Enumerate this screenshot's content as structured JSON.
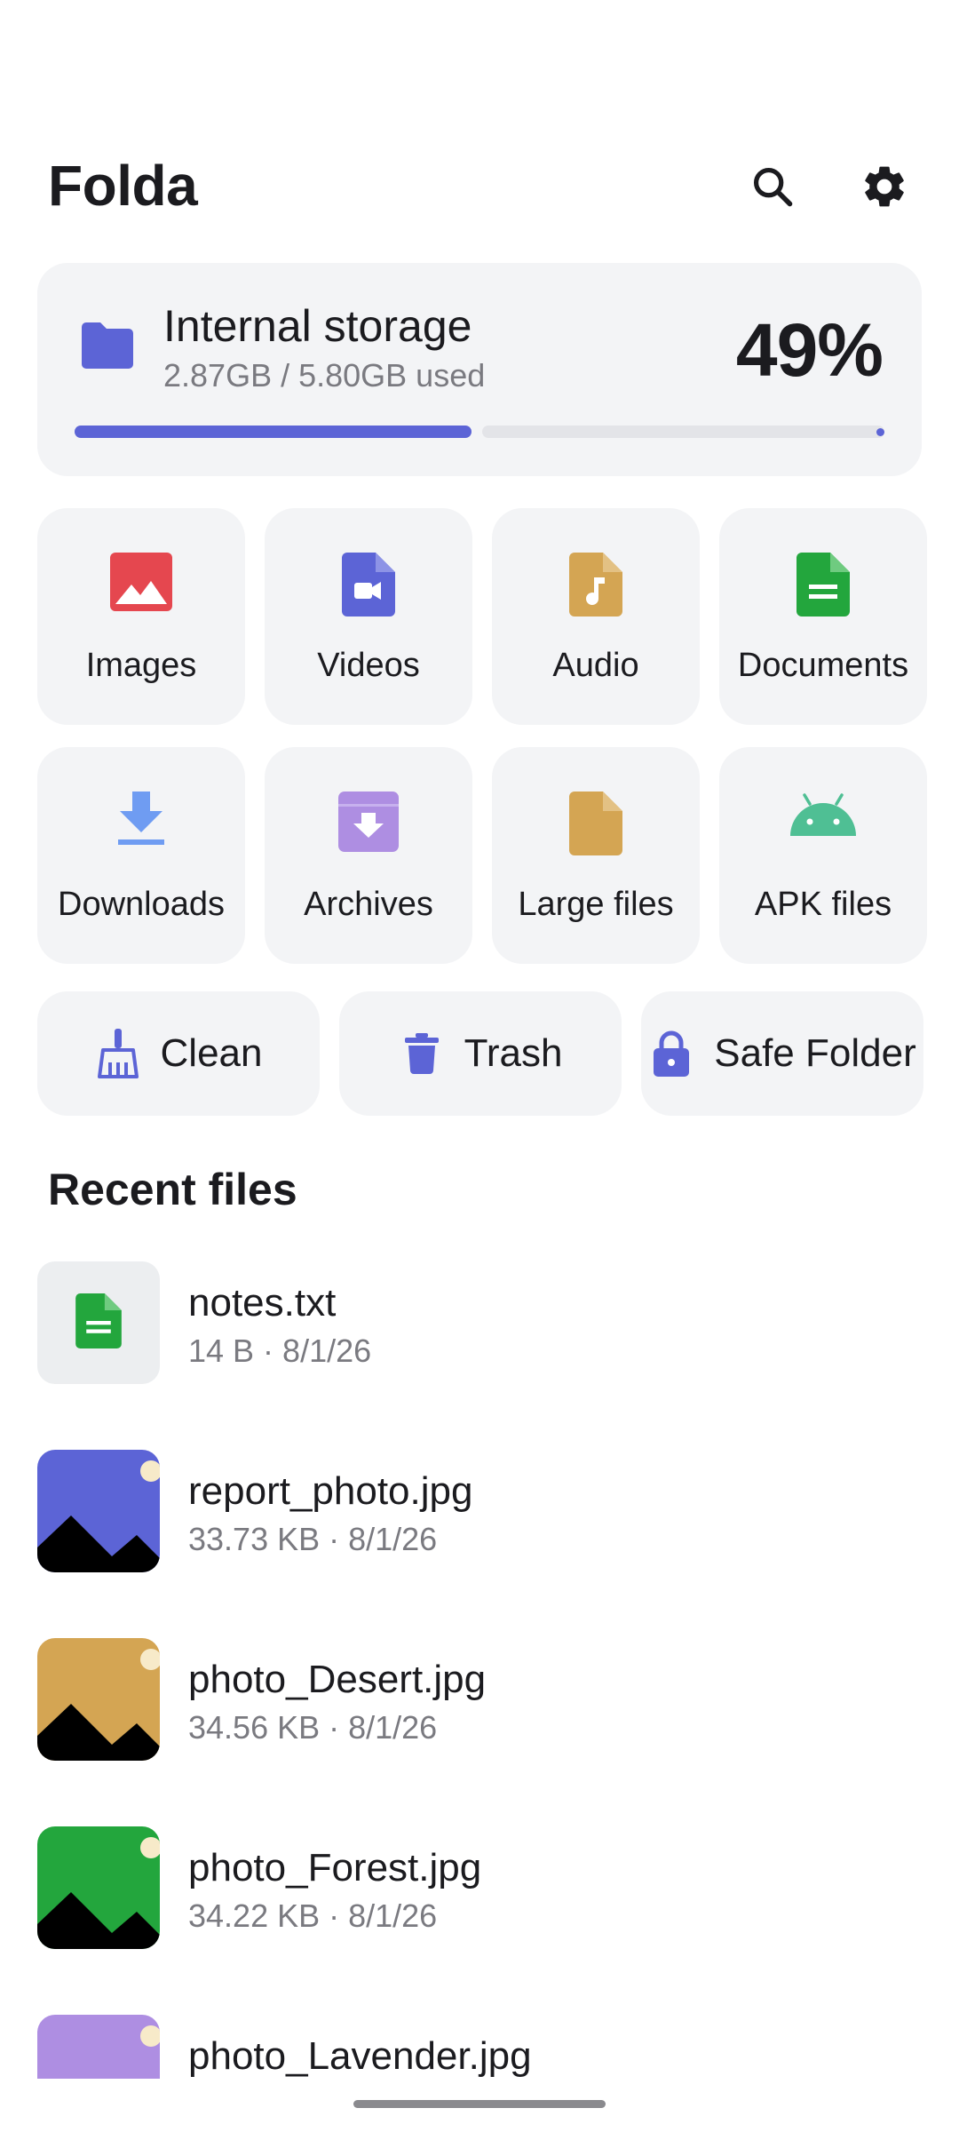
{
  "app": {
    "title": "Folda"
  },
  "header": {
    "search_icon": "search-icon",
    "settings_icon": "gear-icon"
  },
  "storage": {
    "title": "Internal storage",
    "used_text": "2.87GB / 5.80GB used",
    "percent_text": "49%",
    "fraction_used": 0.49,
    "accent": "#5c64d6"
  },
  "categories": [
    {
      "label": "Images",
      "icon": "image-icon",
      "color": "#e5474f"
    },
    {
      "label": "Videos",
      "icon": "video-file-icon",
      "color": "#5c64d6"
    },
    {
      "label": "Audio",
      "icon": "music-file-icon",
      "color": "#d4a553"
    },
    {
      "label": "Documents",
      "icon": "document-icon",
      "color": "#23a63d"
    },
    {
      "label": "Downloads",
      "icon": "download-icon",
      "color": "#6f9cf2"
    },
    {
      "label": "Archives",
      "icon": "archive-icon",
      "color": "#ae8ee2"
    },
    {
      "label": "Large files",
      "icon": "file-icon",
      "color": "#d4a553"
    },
    {
      "label": "APK files",
      "icon": "android-icon",
      "color": "#4fbf94"
    }
  ],
  "actions": [
    {
      "label": "Clean",
      "icon": "broom-icon"
    },
    {
      "label": "Trash",
      "icon": "trash-icon"
    },
    {
      "label": "Safe Folder",
      "icon": "lock-icon"
    }
  ],
  "recent": {
    "title": "Recent files",
    "files": [
      {
        "name": "notes.txt",
        "meta": "14 B · 8/1/26",
        "thumb": "document",
        "color": "#23a63d"
      },
      {
        "name": "report_photo.jpg",
        "meta": "33.73 KB · 8/1/26",
        "thumb": "photo",
        "color": "#5c64d6"
      },
      {
        "name": "photo_Desert.jpg",
        "meta": "34.56 KB · 8/1/26",
        "thumb": "photo",
        "color": "#d4a553"
      },
      {
        "name": "photo_Forest.jpg",
        "meta": "34.22 KB · 8/1/26",
        "thumb": "photo",
        "color": "#23a63d"
      },
      {
        "name": "photo_Lavender.jpg",
        "meta": "",
        "thumb": "photo",
        "color": "#ae8ee2"
      }
    ]
  },
  "colors": {
    "tile_bg": "#f3f4f6",
    "icon_accent": "#5c64d6",
    "text_secondary": "#7a7a80"
  }
}
